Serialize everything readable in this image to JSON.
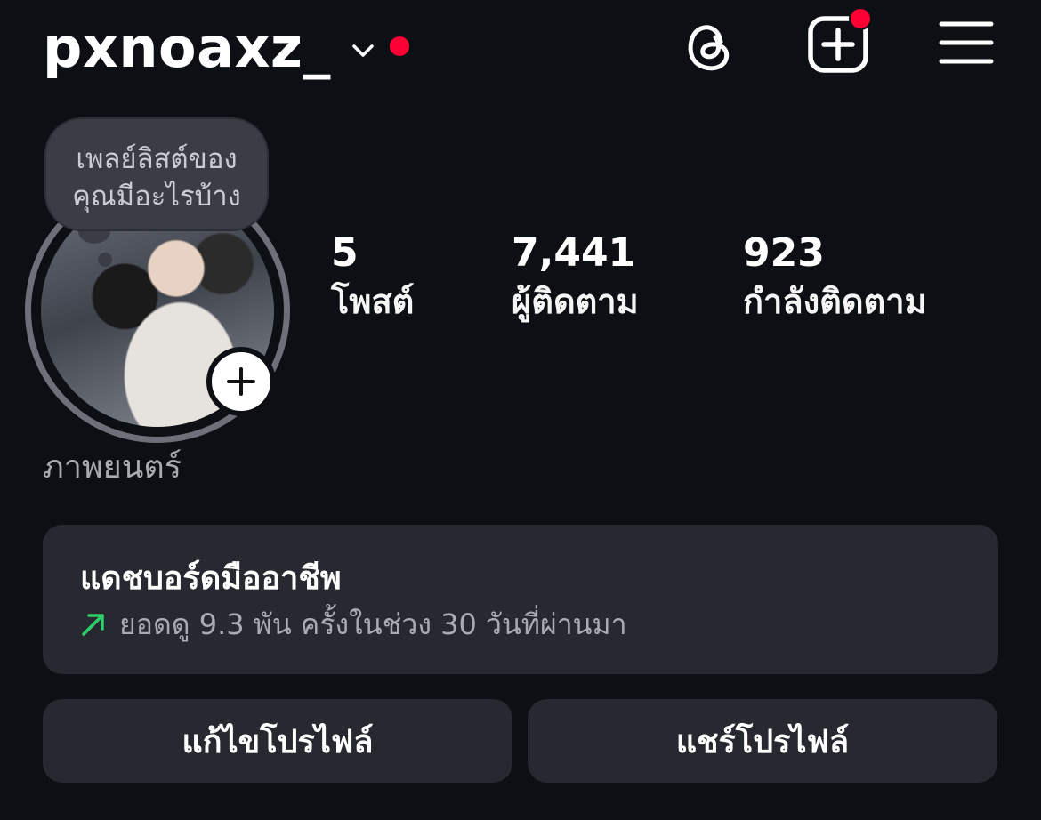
{
  "header": {
    "username": "pxnoaxz_",
    "has_notification": true,
    "create_has_notification": true,
    "icons": [
      "chevron-down-icon",
      "threads-icon",
      "create-post-icon",
      "menu-icon"
    ]
  },
  "note": {
    "text_line1": "เพลย์ลิสต์ของ",
    "text_line2": "คุณมีอะไรบ้าง"
  },
  "stats": {
    "posts": {
      "value": "5",
      "label": "โพสต์"
    },
    "followers": {
      "value": "7,441",
      "label": "ผู้ติดตาม"
    },
    "following": {
      "value": "923",
      "label": "กำลังติดตาม"
    }
  },
  "profile": {
    "category": "ภาพยนตร์"
  },
  "dashboard": {
    "title": "แดชบอร์ดมืออาชีพ",
    "subtitle": "ยอดดู 9.3 พัน ครั้งในช่วง 30 วันที่ผ่านมา",
    "trend_icon": "trend-up-arrow-icon",
    "trend_color": "#2fd06b"
  },
  "actions": {
    "edit_profile": "แก้ไขโปรไฟล์",
    "share_profile": "แชร์โปรไฟล์"
  },
  "colors": {
    "background": "#0c1014",
    "card": "#262930",
    "notification": "#ff0034"
  }
}
